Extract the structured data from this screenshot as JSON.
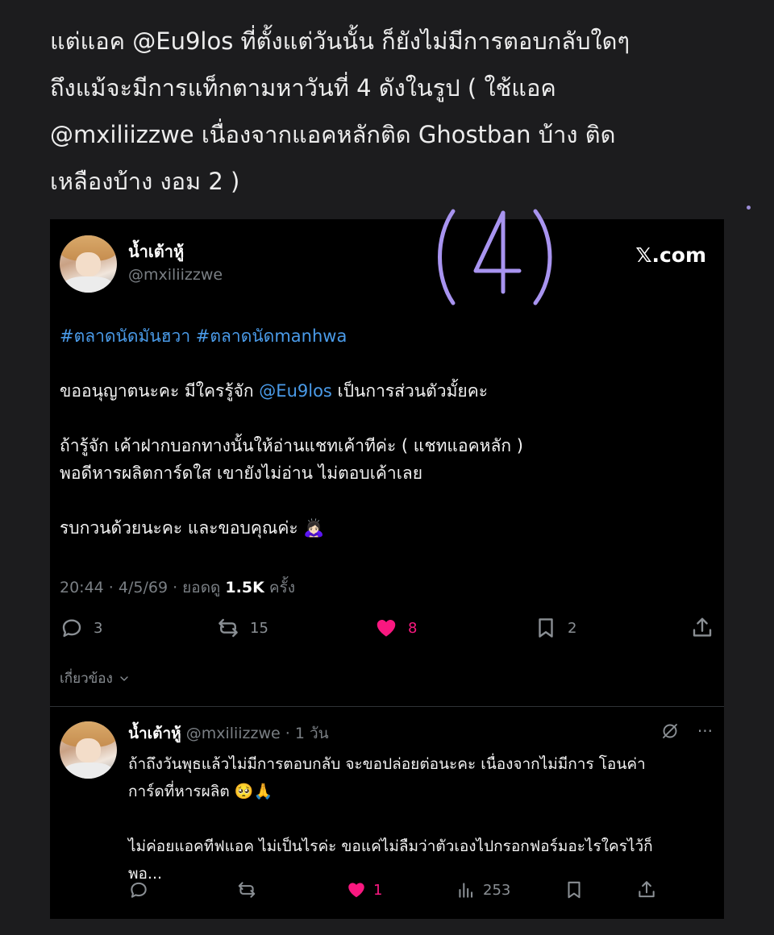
{
  "caption": {
    "line1": "แต่แอค @Eu9los ที่ตั้งแต่วันนั้น ก็ยังไม่มีการตอบกลับใดๆ",
    "line2": "ถึงแม้จะมีการแท็กตามหาวันที่ 4 ดังในรูป ( ใช้แอค",
    "line3": "@mxiliizzwe เนื่องจากแอคหลักติด Ghostban บ้าง ติด",
    "line4": "เหลืองบ้าง งอม 2 )"
  },
  "annotation": {
    "text": "(4)",
    "color": "#a894f0"
  },
  "post": {
    "display_name": "น้ำเต้าหู้",
    "handle": "@mxiliizzwe",
    "source_logo": "𝕏.com",
    "hashtags": "#ตลาดนัดมันฮวา #ตลาดนัดmanhwa",
    "p1_before": "ขออนุญาตนะคะ มีใครรู้จัก ",
    "p1_mention": "@Eu9los",
    "p1_after": " เป็นการส่วนตัวมั้ยคะ",
    "p2_line1": "ถ้ารู้จัก เค้าฝากบอกทางนั้นให้อ่านแชทเค้าทีค่ะ ( แชทแอคหลัก )",
    "p2_line2": "พอดีหารผลิตการ์ดใส เขายังไม่อ่าน ไม่ตอบเค้าเลย",
    "p3": "รบกวนด้วยนะคะ และขอบคุณค่ะ 🙇🏻‍♀️",
    "meta_prefix": "20:44 · 4/5/69 · ยอดดู ",
    "views": "1.5K",
    "meta_suffix": " ครั้ง",
    "actions": {
      "replies": "3",
      "reposts": "15",
      "likes": "8",
      "bookmarks": "2"
    },
    "related_label": "เกี่ยวข้อง",
    "like_color": "#f91880",
    "link_color": "#4a9be9"
  },
  "reply": {
    "display_name": "น้ำเต้าหู้",
    "handle_time": "@mxiliizzwe · 1 วัน",
    "line1": "ถ้าถึงวันพุธแล้วไม่มีการตอบกลับ จะขอปล่อยต่อนะคะ เนื่องจากไม่มีการ โอนค่า",
    "line2": "การ์ดที่หารผลิต 🥺🙏",
    "line3": "ไม่ค่อยแอคทีฟแอค ไม่เป็นไรค่ะ ขอแค่ไม่ลืมว่าตัวเองไปกรอกฟอร์มอะไรใครไว้ก็",
    "line4": "พอ...",
    "more": "···",
    "actions": {
      "replies": "",
      "reposts": "",
      "likes": "1",
      "views": "253"
    }
  }
}
